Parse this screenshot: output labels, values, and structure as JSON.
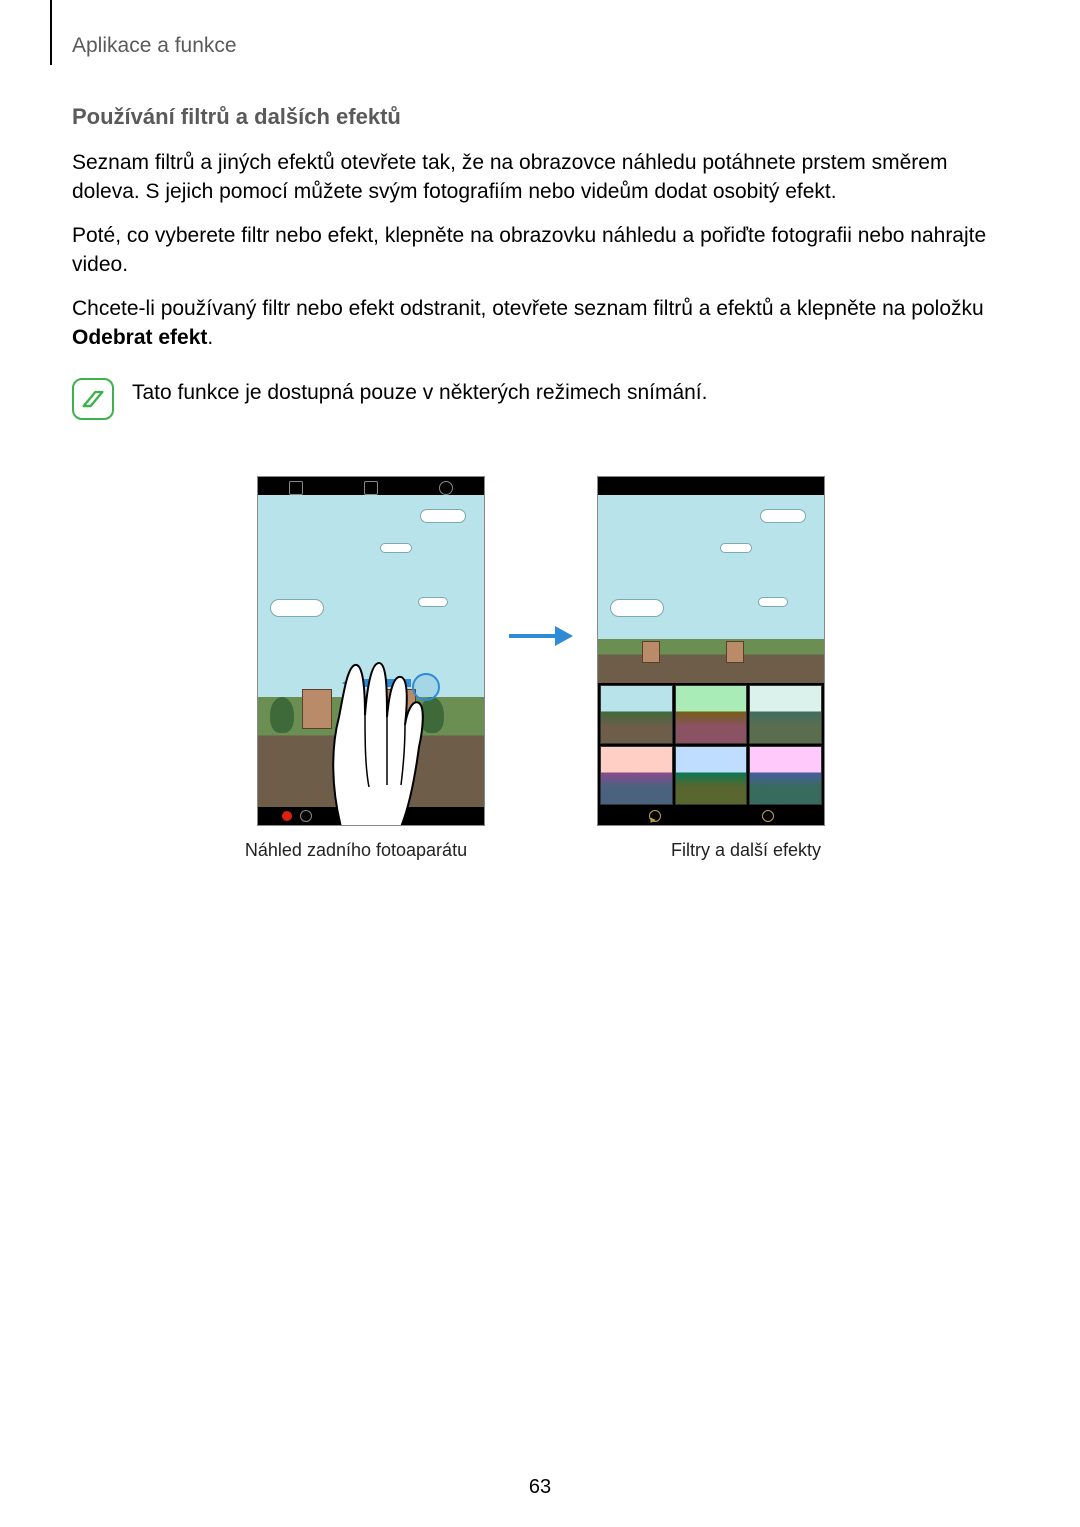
{
  "page": {
    "breadcrumb": "Aplikace a funkce",
    "number": "63"
  },
  "section": {
    "title": "Používání filtrů a dalších efektů",
    "p1": "Seznam filtrů a jiných efektů otevřete tak, že na obrazovce náhledu potáhnete prstem směrem doleva. S jejich pomocí můžete svým fotografiím nebo videům dodat osobitý efekt.",
    "p2": "Poté, co vyberete filtr nebo efekt, klepněte na obrazovku náhledu a pořiďte fotografii nebo nahrajte video.",
    "p3a": "Chcete-li používaný filtr nebo efekt odstranit, otevřete seznam filtrů a efektů a klepněte na položku ",
    "p3b": "Odebrat efekt",
    "p3c": ".",
    "note": "Tato funkce je dostupná pouze v některých režimech snímání."
  },
  "figure": {
    "caption_left": "Náhled zadního fotoaparátu",
    "caption_right": "Filtry a další efekty"
  }
}
